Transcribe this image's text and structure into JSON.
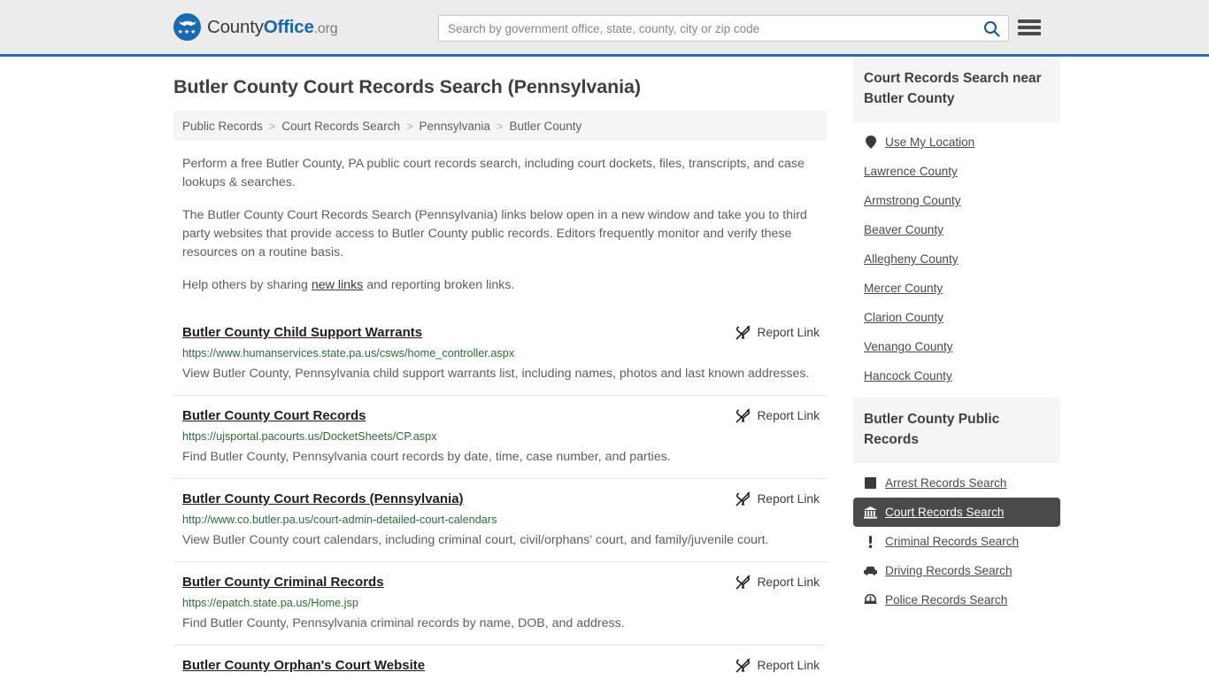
{
  "header": {
    "brand": {
      "part1": "County",
      "part2": "Office",
      "part3": ".org",
      "logo_icon": "eagle-seal-icon",
      "stars": "★★★"
    },
    "search": {
      "value": "",
      "placeholder": "Search by government office, state, county, city or zip code",
      "button_icon": "search-icon"
    },
    "menu_icon": "hamburger-menu-icon",
    "accent_color": "#2d6da3",
    "background_color": "#ececec"
  },
  "page_title": "Butler County Court Records Search (Pennsylvania)",
  "breadcrumb": {
    "separator": ">",
    "items": [
      {
        "label": "Public Records"
      },
      {
        "label": "Court Records Search"
      },
      {
        "label": "Pennsylvania"
      },
      {
        "label": "Butler County"
      }
    ]
  },
  "intro": {
    "p1": "Perform a free Butler County, PA public court records search, including court dockets, files, transcripts, and case lookups & searches.",
    "p2": "The Butler County Court Records Search (Pennsylvania) links below open in a new window and take you to third party websites that provide access to Butler County public records. Editors frequently monitor and verify these resources on a routine basis.",
    "p3_before": "Help others by sharing ",
    "p3_link": "new links",
    "p3_after": " and reporting broken links."
  },
  "report_link_label": "Report Link",
  "report_link_icon": "broken-link-icon",
  "results": [
    {
      "title": "Butler County Child Support Warrants",
      "url": "https://www.humanservices.state.pa.us/csws/home_controller.aspx",
      "description": "View Butler County, Pennsylvania child support warrants list, including names, photos and last known addresses."
    },
    {
      "title": "Butler County Court Records",
      "url": "https://ujsportal.pacourts.us/DocketSheets/CP.aspx",
      "description": "Find Butler County, Pennsylvania court records by date, time, case number, and parties."
    },
    {
      "title": "Butler County Court Records (Pennsylvania)",
      "url": "http://www.co.butler.pa.us/court-admin-detailed-court-calendars",
      "description": "View Butler County court calendars, including criminal court, civil/orphans' court, and family/juvenile court."
    },
    {
      "title": "Butler County Criminal Records",
      "url": "https://epatch.state.pa.us/Home.jsp",
      "description": "Find Butler County, Pennsylvania criminal records by name, DOB, and address."
    },
    {
      "title": "Butler County Orphan's Court Website",
      "url": "",
      "description": ""
    }
  ],
  "sidebar": {
    "nearby": {
      "heading": "Court Records Search near Butler County",
      "items": [
        {
          "label": "Use My Location",
          "icon": "map-pin-icon"
        },
        {
          "label": "Lawrence County",
          "icon": ""
        },
        {
          "label": "Armstrong County",
          "icon": ""
        },
        {
          "label": "Beaver County",
          "icon": ""
        },
        {
          "label": "Allegheny County",
          "icon": ""
        },
        {
          "label": "Mercer County",
          "icon": ""
        },
        {
          "label": "Clarion County",
          "icon": ""
        },
        {
          "label": "Venango County",
          "icon": ""
        },
        {
          "label": "Hancock County",
          "icon": ""
        }
      ]
    },
    "public_records": {
      "heading": "Butler County Public Records",
      "items": [
        {
          "label": "Arrest Records Search",
          "icon": "book-icon",
          "active": false
        },
        {
          "label": "Court Records Search",
          "icon": "courthouse-icon",
          "active": true
        },
        {
          "label": "Criminal Records Search",
          "icon": "exclamation-icon",
          "active": false
        },
        {
          "label": "Driving Records Search",
          "icon": "car-icon",
          "active": false
        },
        {
          "label": "Police Records Search",
          "icon": "police-badge-icon",
          "active": false
        }
      ]
    }
  }
}
